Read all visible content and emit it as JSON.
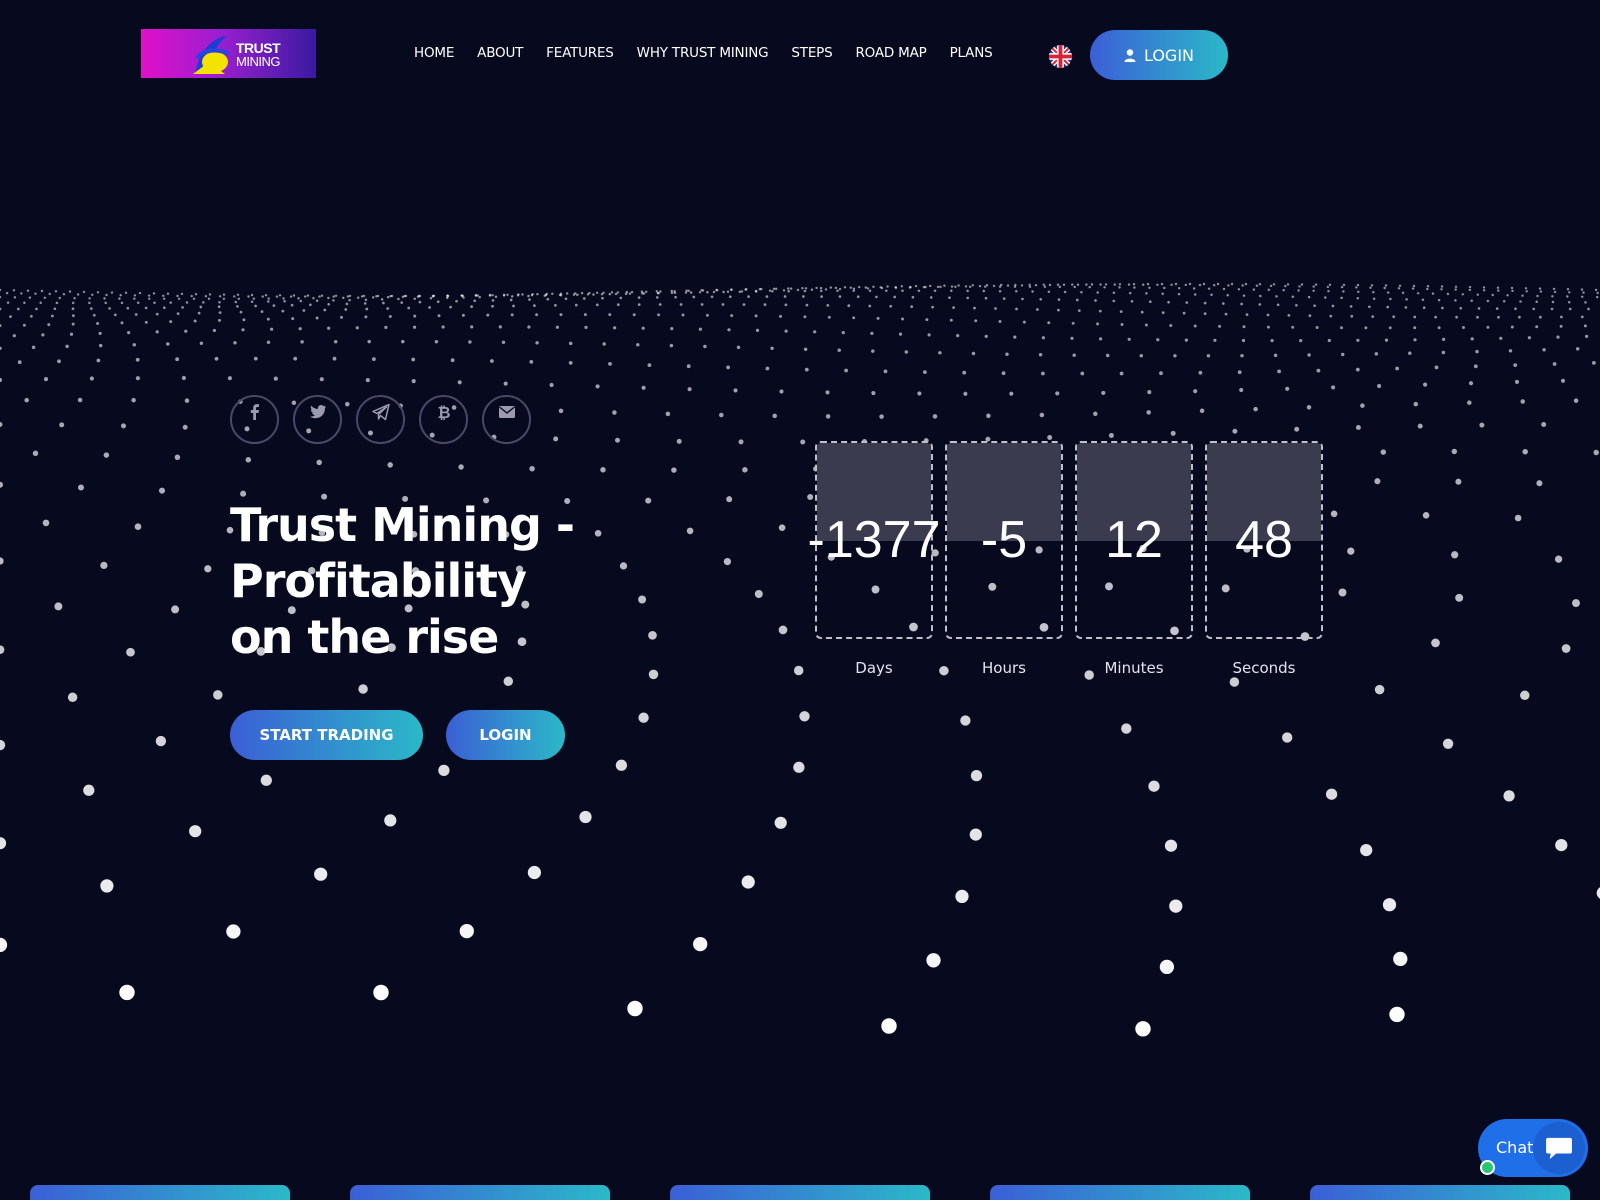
{
  "header": {
    "logo": {
      "line1": "TRUST",
      "line2": "MINING"
    },
    "nav": [
      {
        "label": "HOME"
      },
      {
        "label": "ABOUT"
      },
      {
        "label": "FEATURES"
      },
      {
        "label": "WHY TRUST MINING"
      },
      {
        "label": "STEPS"
      },
      {
        "label": "ROAD MAP"
      },
      {
        "label": "PLANS"
      }
    ],
    "language_icon": "uk-flag-icon",
    "login_label": "LOGIN"
  },
  "social": [
    {
      "icon": "facebook-icon"
    },
    {
      "icon": "twitter-icon"
    },
    {
      "icon": "telegram-icon"
    },
    {
      "icon": "bitcoin-icon"
    },
    {
      "icon": "email-icon"
    }
  ],
  "hero": {
    "line1": "Trust Mining -",
    "line2": "Profitability",
    "line3": "on the rise",
    "start_label": "START TRADING",
    "login_label": "LOGIN"
  },
  "countdown": [
    {
      "value": "-1377",
      "label": "Days"
    },
    {
      "value": "-5",
      "label": "Hours"
    },
    {
      "value": "12",
      "label": "Minutes"
    },
    {
      "value": "48",
      "label": "Seconds"
    }
  ],
  "chat": {
    "label": "Chat"
  },
  "colors": {
    "background": "#070a1f",
    "accent_start": "#3b5fd6",
    "accent_end": "#2bb8c8",
    "chat": "#1e6fe8",
    "online": "#28c76f"
  }
}
